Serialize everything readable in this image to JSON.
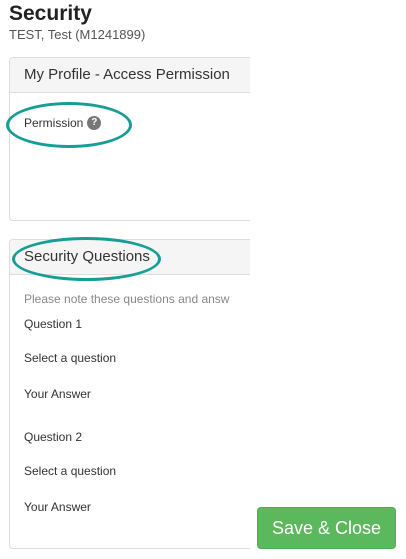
{
  "header": {
    "title": "Security",
    "subtitle": "TEST, Test (M1241899)"
  },
  "permission_panel": {
    "heading": "My Profile - Access Permission",
    "label": "Permission",
    "help_icon": "?"
  },
  "security_panel": {
    "heading": "Security Questions",
    "note": "Please note these questions and answ",
    "questions": [
      {
        "label": "Question 1",
        "select_placeholder": "Select a question",
        "answer_placeholder": "Your Answer"
      },
      {
        "label": "Question 2",
        "select_placeholder": "Select a question",
        "answer_placeholder": "Your Answer"
      }
    ]
  },
  "footer": {
    "save_close_label": "Save & Close"
  },
  "colors": {
    "highlight": "#169e96",
    "save_button": "#5cb85c"
  },
  "icons": {
    "help": "question-circle-icon"
  }
}
